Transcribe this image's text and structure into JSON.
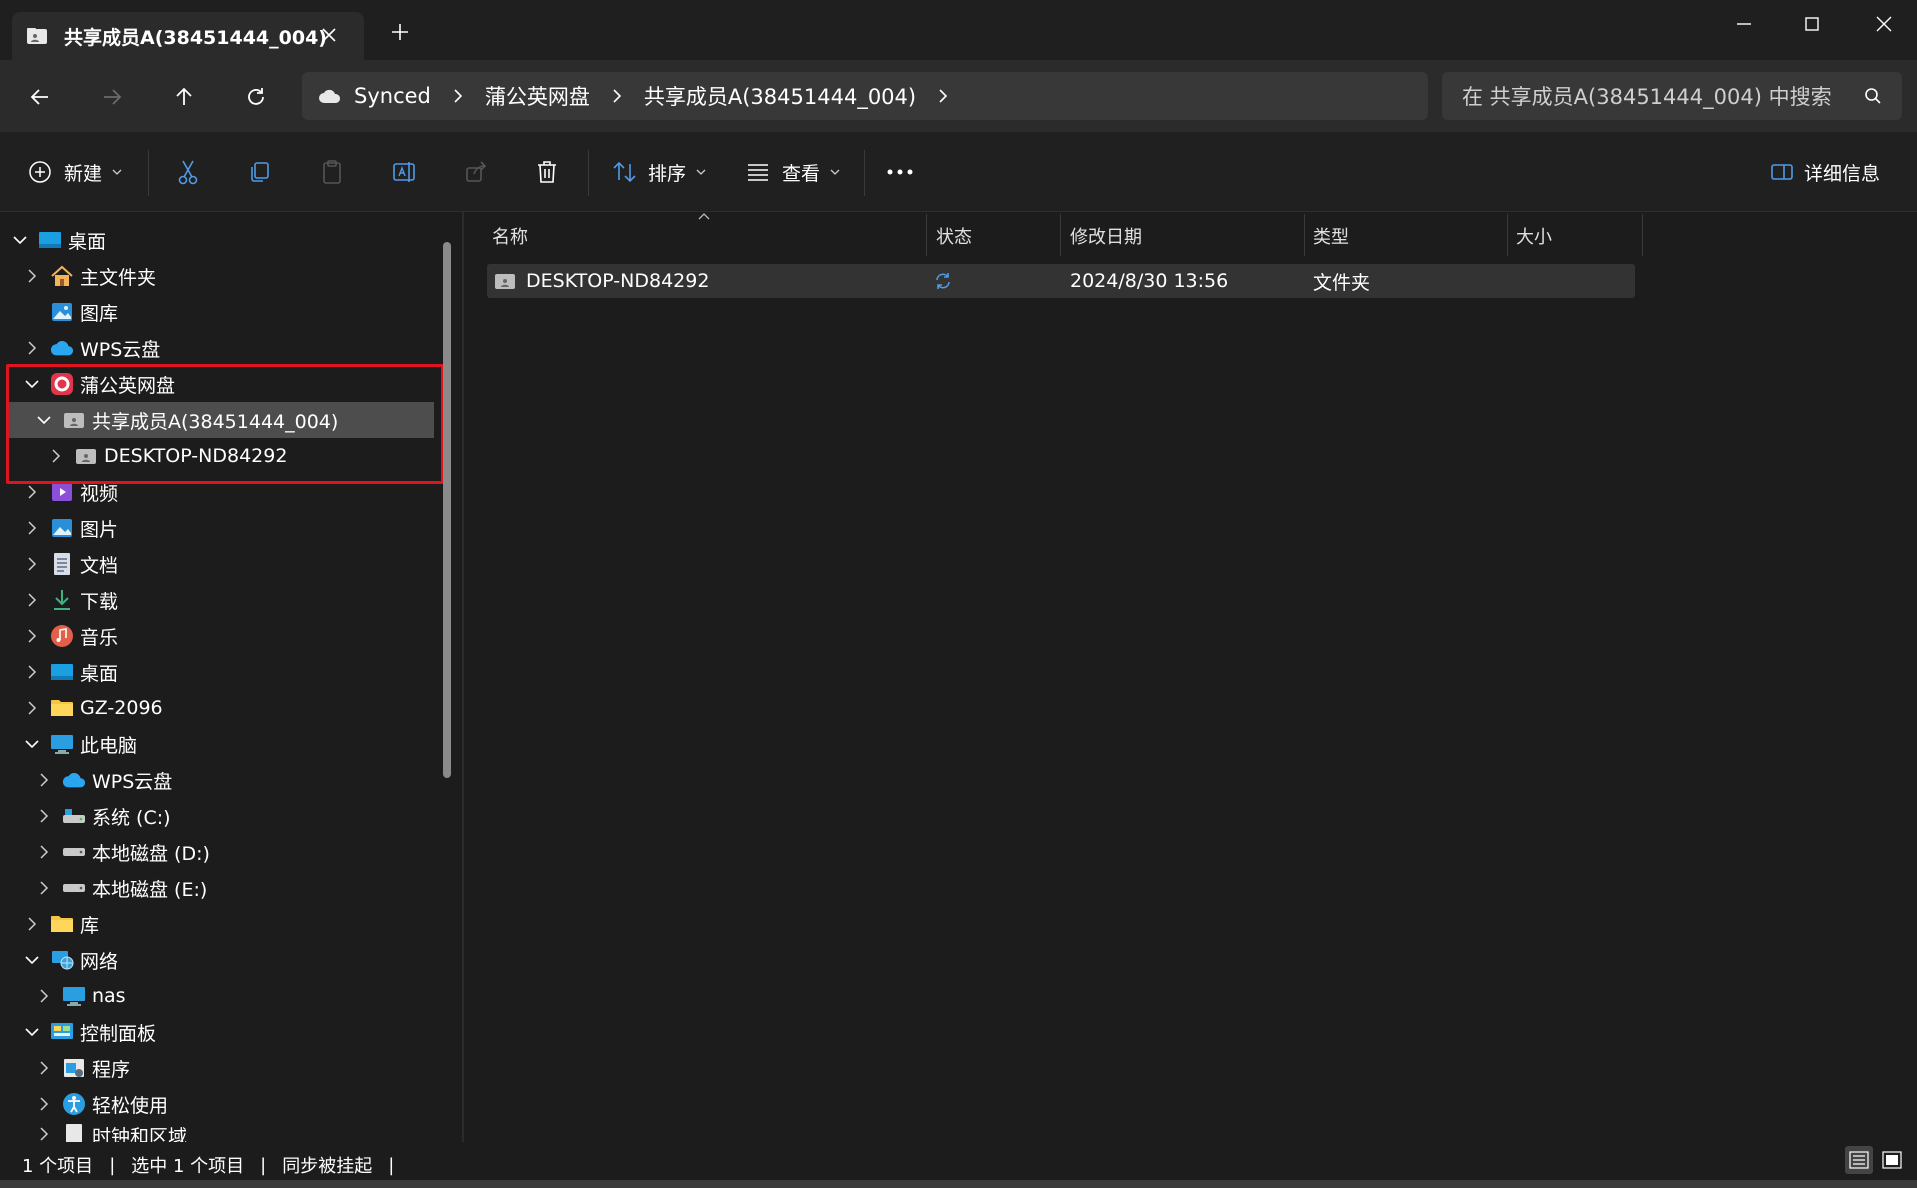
{
  "tab": {
    "title": "共享成员A(38451444_004)"
  },
  "address": {
    "crumbs": [
      "Synced",
      "蒲公英网盘",
      "共享成员A(38451444_004)"
    ],
    "search_placeholder": "在 共享成员A(38451444_004) 中搜索"
  },
  "toolbar": {
    "new_label": "新建",
    "sort_label": "排序",
    "view_label": "查看",
    "details_label": "详细信息"
  },
  "sidebar": {
    "items": [
      {
        "label": "桌面",
        "icon": "desktop-icon"
      },
      {
        "label": "主文件夹",
        "icon": "home-icon"
      },
      {
        "label": "图库",
        "icon": "gallery-icon"
      },
      {
        "label": "WPS云盘",
        "icon": "cloud-icon"
      },
      {
        "label": "蒲公英网盘",
        "icon": "pugongying-icon"
      },
      {
        "label": "共享成员A(38451444_004)",
        "icon": "shared-folder-icon"
      },
      {
        "label": "DESKTOP-ND84292",
        "icon": "shared-folder-icon"
      },
      {
        "label": "视频",
        "icon": "video-icon"
      },
      {
        "label": "图片",
        "icon": "pictures-icon"
      },
      {
        "label": "文档",
        "icon": "documents-icon"
      },
      {
        "label": "下载",
        "icon": "download-icon"
      },
      {
        "label": "音乐",
        "icon": "music-icon"
      },
      {
        "label": "桌面",
        "icon": "desktop-icon"
      },
      {
        "label": "GZ-2096",
        "icon": "folder-icon"
      },
      {
        "label": "此电脑",
        "icon": "computer-icon"
      },
      {
        "label": "WPS云盘",
        "icon": "cloud-icon"
      },
      {
        "label": "系统 (C:)",
        "icon": "drive-icon"
      },
      {
        "label": "本地磁盘 (D:)",
        "icon": "drive-icon"
      },
      {
        "label": "本地磁盘 (E:)",
        "icon": "drive-icon"
      },
      {
        "label": "库",
        "icon": "folder-icon"
      },
      {
        "label": "网络",
        "icon": "network-icon"
      },
      {
        "label": "nas",
        "icon": "computer-icon"
      },
      {
        "label": "控制面板",
        "icon": "control-panel-icon"
      },
      {
        "label": "程序",
        "icon": "programs-icon"
      },
      {
        "label": "轻松使用",
        "icon": "accessibility-icon"
      },
      {
        "label": "时钟和区域",
        "icon": "clock-region-icon"
      }
    ]
  },
  "columns": {
    "name": "名称",
    "status": "状态",
    "modified": "修改日期",
    "type": "类型",
    "size": "大小"
  },
  "files": [
    {
      "name": "DESKTOP-ND84292",
      "modified": "2024/8/30 13:56",
      "type": "文件夹",
      "size": ""
    }
  ],
  "status": {
    "item_count": "1 个项目",
    "selected": "选中 1 个项目",
    "sync": "同步被挂起"
  },
  "colors": {
    "accent": "#4f9be8",
    "highlight": "#e0141e",
    "selected_row": "#4d4d4d"
  }
}
